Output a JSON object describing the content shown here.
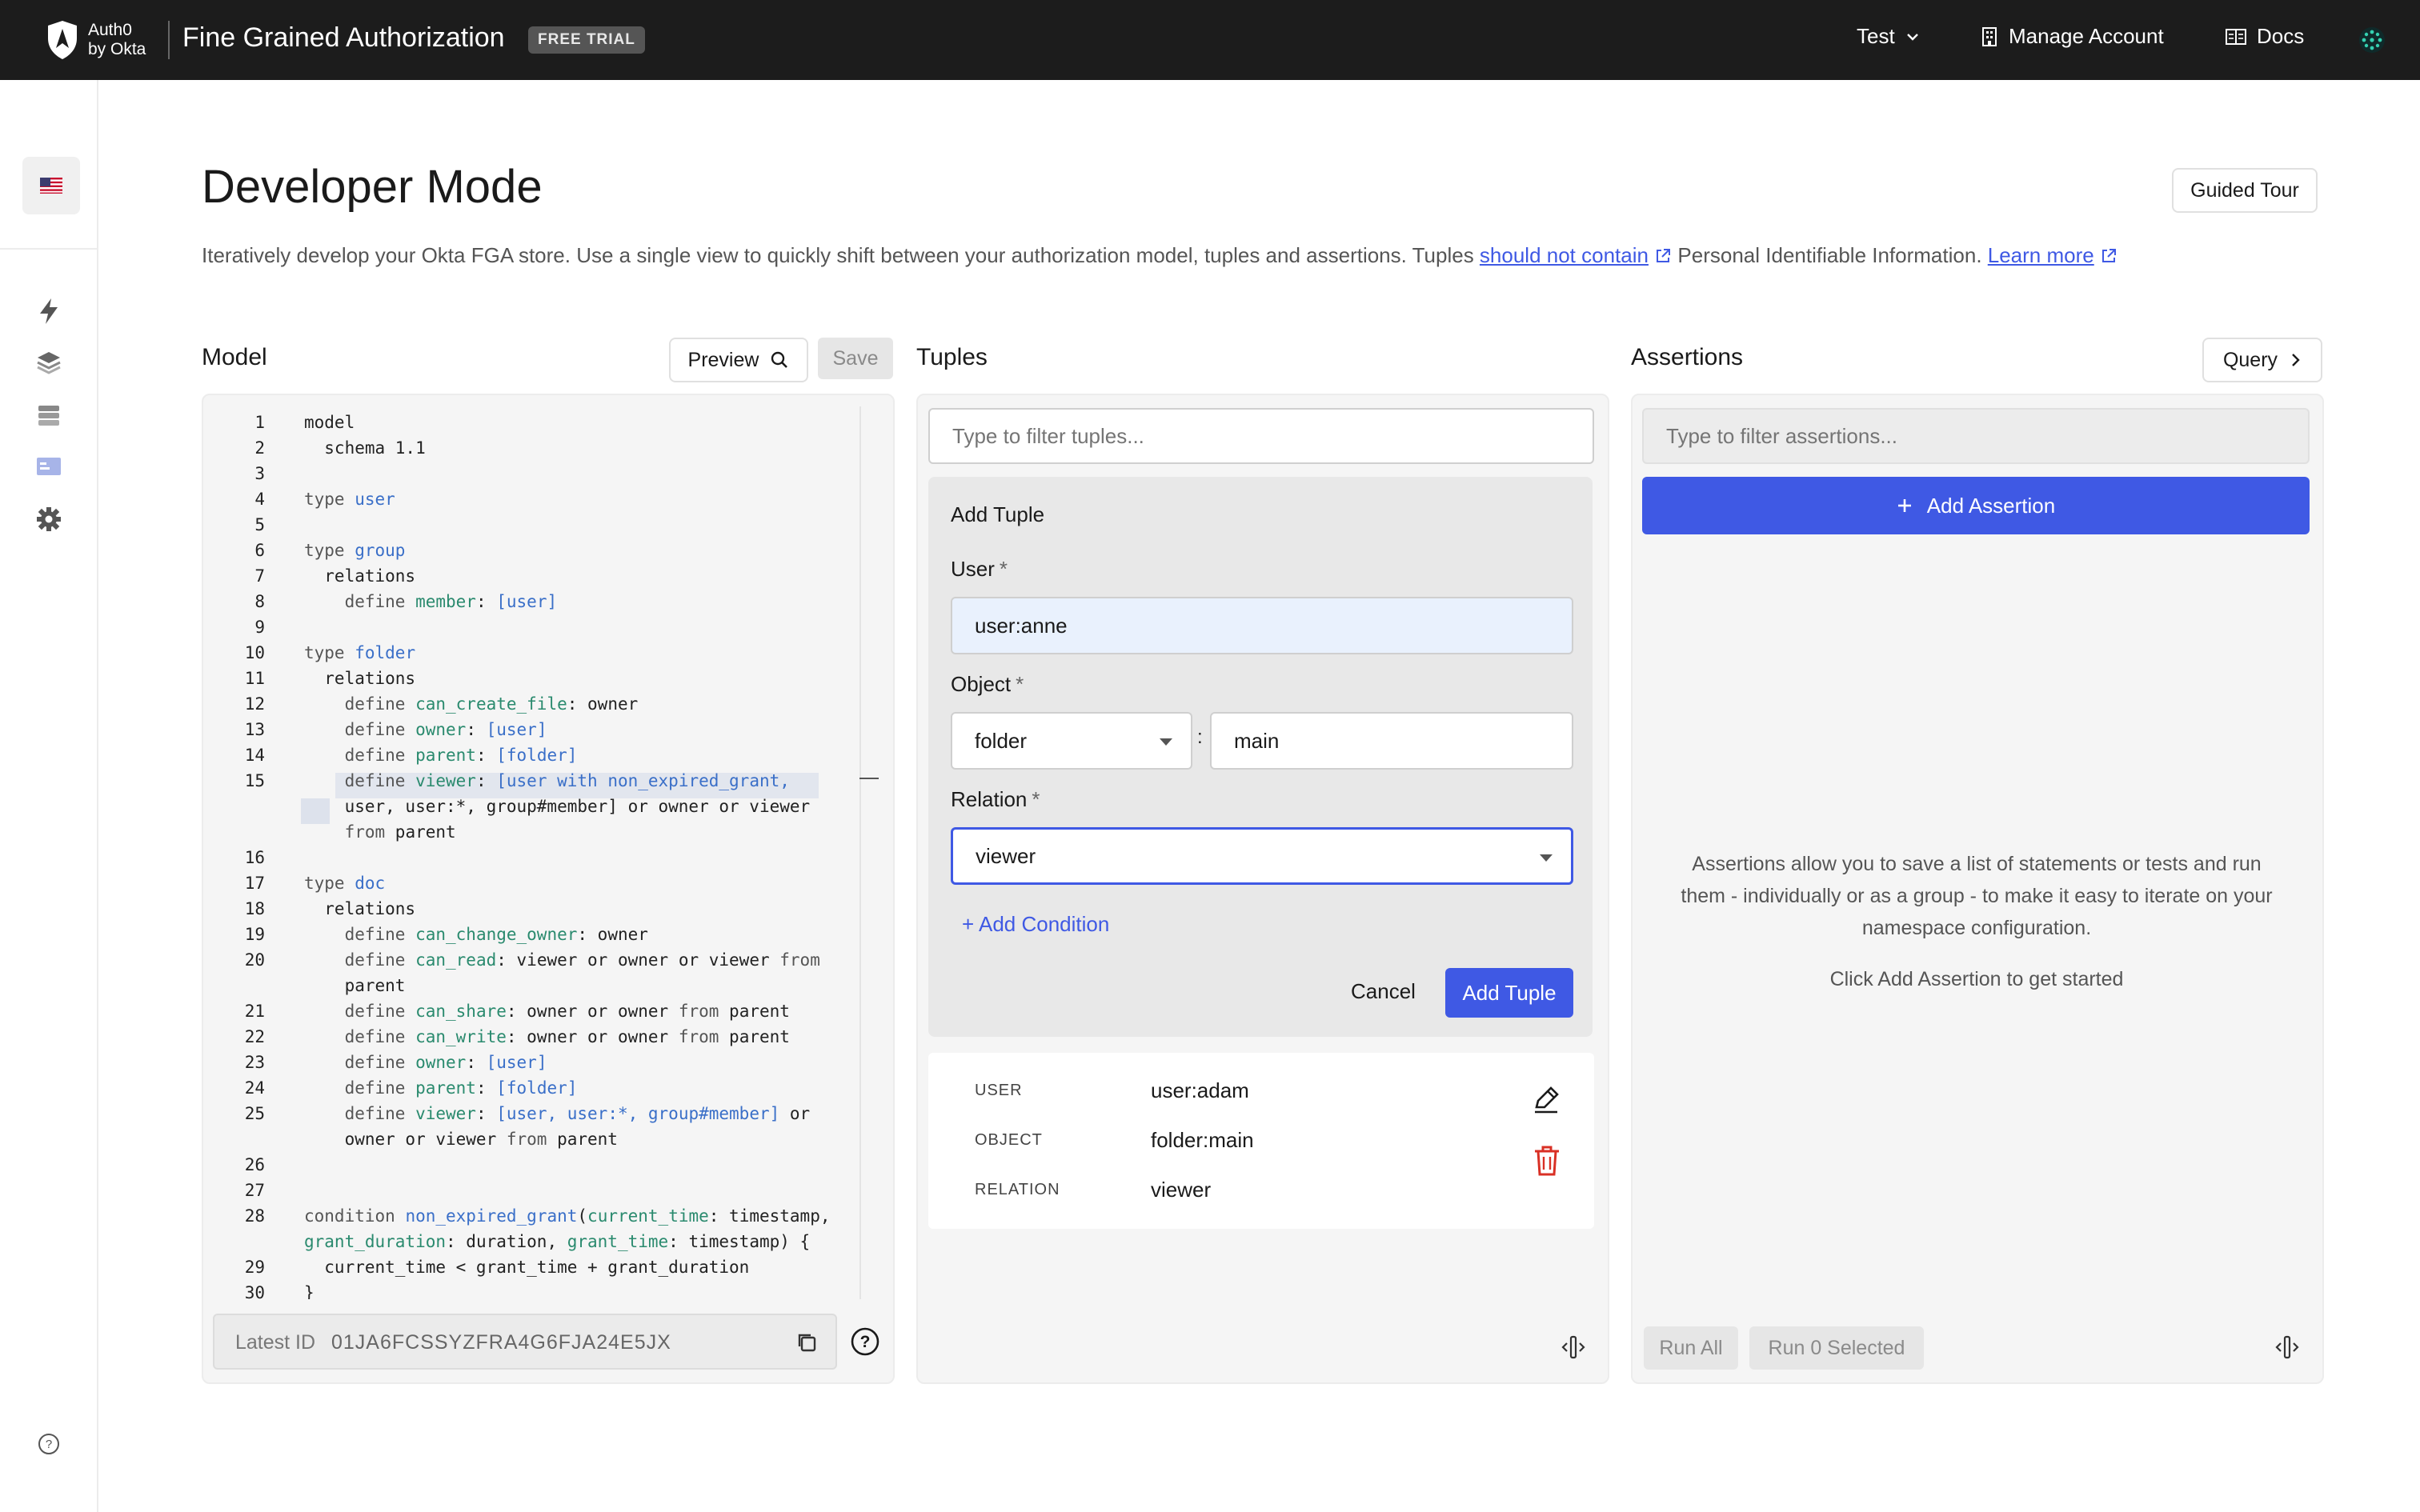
{
  "topbar": {
    "brand_line1": "Auth0",
    "brand_line2": "by Okta",
    "product": "Fine Grained Authorization",
    "trial_badge": "FREE TRIAL",
    "tenant": "Test",
    "manage_account": "Manage Account",
    "docs": "Docs"
  },
  "page": {
    "title": "Developer Mode",
    "desc_part1": "Iteratively develop your Okta FGA store. Use a single view to quickly shift between your authorization model, tuples and assertions. Tuples ",
    "desc_link1": "should not contain",
    "desc_part2": " Personal Identifiable Information. ",
    "desc_link2": "Learn more",
    "guided_tour": "Guided Tour"
  },
  "model": {
    "title": "Model",
    "preview_label": "Preview",
    "save_label": "Save",
    "latest_id_label": "Latest ID",
    "latest_id_value": "01JA6FCSSYZFRA4G6FJA24E5JX",
    "lines": [
      {
        "n": "1",
        "t": "model"
      },
      {
        "n": "2",
        "t": "  schema 1.1"
      },
      {
        "n": "3",
        "t": ""
      },
      {
        "n": "4",
        "t": "type user"
      },
      {
        "n": "5",
        "t": ""
      },
      {
        "n": "6",
        "t": "type group"
      },
      {
        "n": "7",
        "t": "  relations"
      },
      {
        "n": "8",
        "t": "    define member: [user]"
      },
      {
        "n": "9",
        "t": ""
      },
      {
        "n": "10",
        "t": "type folder"
      },
      {
        "n": "11",
        "t": "  relations"
      },
      {
        "n": "12",
        "t": "    define can_create_file: owner"
      },
      {
        "n": "13",
        "t": "    define owner: [user]"
      },
      {
        "n": "14",
        "t": "    define parent: [folder]"
      },
      {
        "n": "15",
        "t": "    define viewer: [user with non_expired_grant,"
      },
      {
        "n": "",
        "t": "    user, user:*, group#member] or owner or viewer"
      },
      {
        "n": "",
        "t": "    from parent"
      },
      {
        "n": "16",
        "t": ""
      },
      {
        "n": "17",
        "t": "type doc"
      },
      {
        "n": "18",
        "t": "  relations"
      },
      {
        "n": "19",
        "t": "    define can_change_owner: owner"
      },
      {
        "n": "20",
        "t": "    define can_read: viewer or owner or viewer from"
      },
      {
        "n": "",
        "t": "    parent"
      },
      {
        "n": "21",
        "t": "    define can_share: owner or owner from parent"
      },
      {
        "n": "22",
        "t": "    define can_write: owner or owner from parent"
      },
      {
        "n": "23",
        "t": "    define owner: [user]"
      },
      {
        "n": "24",
        "t": "    define parent: [folder]"
      },
      {
        "n": "25",
        "t": "    define viewer: [user, user:*, group#member] or"
      },
      {
        "n": "",
        "t": "    owner or viewer from parent"
      },
      {
        "n": "26",
        "t": ""
      },
      {
        "n": "27",
        "t": ""
      },
      {
        "n": "28",
        "t": "condition non_expired_grant(current_time: timestamp,"
      },
      {
        "n": "",
        "t": "grant_duration: duration, grant_time: timestamp) {"
      },
      {
        "n": "29",
        "t": "  current_time < grant_time + grant_duration"
      },
      {
        "n": "30",
        "t": "}"
      }
    ]
  },
  "tuples": {
    "title": "Tuples",
    "filter_placeholder": "Type to filter tuples...",
    "add_tuple": {
      "heading": "Add Tuple",
      "user_label": "User",
      "user_value": "user:anne",
      "object_label": "Object",
      "object_type": "folder",
      "object_sep": ":",
      "object_id": "main",
      "relation_label": "Relation",
      "relation_value": "viewer",
      "add_condition": "+ Add Condition",
      "cancel": "Cancel",
      "submit": "Add Tuple",
      "required_mark": "*"
    },
    "existing": {
      "user_key": "USER",
      "user_val": "user:adam",
      "object_key": "OBJECT",
      "object_val": "folder:main",
      "relation_key": "RELATION",
      "relation_val": "viewer"
    }
  },
  "assertions": {
    "title": "Assertions",
    "query_label": "Query",
    "filter_placeholder": "Type to filter assertions...",
    "add_label": "Add Assertion",
    "empty_text": "Assertions allow you to save a list of statements or tests and run them - individually or as a group - to make it easy to iterate on your namespace configuration.",
    "empty_cta": "Click Add Assertion to get started",
    "run_all": "Run All",
    "run_selected": "Run 0 Selected"
  },
  "colors": {
    "accent": "#3f59e4",
    "topbar_bg": "#1c1c1c",
    "delete_red": "#d93025",
    "input_highlight": "#e9f1fd"
  }
}
